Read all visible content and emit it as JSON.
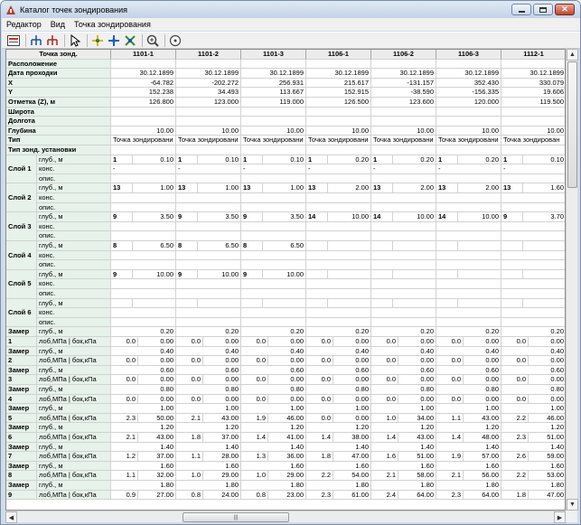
{
  "window": {
    "title": "Каталог точек зондирования"
  },
  "menu": [
    "Редактор",
    "Вид",
    "Точка зондирования"
  ],
  "toolbar": {
    "icons": [
      "report-icon",
      "sort-tree-blue-icon",
      "sort-tree-red-icon",
      "pointer-icon",
      "point-add-icon",
      "point-move-icon",
      "point-delete-icon",
      "zoom-icon",
      "target-icon"
    ]
  },
  "grid": {
    "corner": "Точка зонд.",
    "columns": [
      "1101-1",
      "1101-2",
      "1101-3",
      "1106-1",
      "1106-2",
      "1106-3",
      "1112-1"
    ],
    "rows": [
      {
        "label": "Расположение",
        "values": [
          "",
          "",
          "",
          "",
          "",
          "",
          ""
        ]
      },
      {
        "label": "Дата проходки",
        "values": [
          "30.12.1899",
          "30.12.1899",
          "30.12.1899",
          "30.12.1899",
          "30.12.1899",
          "30.12.1899",
          "30.12.1899"
        ]
      },
      {
        "label": "X",
        "values": [
          "-64.782",
          "-202.272",
          "256.931",
          "215.617",
          "-131.157",
          "352.430",
          "330.079"
        ]
      },
      {
        "label": "Y",
        "values": [
          "152.238",
          "34.493",
          "113.667",
          "152.915",
          "-38.590",
          "-156.335",
          "19.606"
        ]
      },
      {
        "label": "Отметка (Z), м",
        "values": [
          "126.800",
          "123.000",
          "119.000",
          "126.500",
          "123.600",
          "120.000",
          "119.500"
        ]
      },
      {
        "label": "Широта",
        "values": [
          "",
          "",
          "",
          "",
          "",
          "",
          ""
        ]
      },
      {
        "label": "Долгота",
        "values": [
          "",
          "",
          "",
          "",
          "",
          "",
          ""
        ]
      },
      {
        "label": "Глубина",
        "values": [
          "10.00",
          "10.00",
          "10.00",
          "10.00",
          "10.00",
          "10.00",
          "10.00"
        ]
      },
      {
        "label": "Тип",
        "values": [
          "Точка зондировани",
          "Точка зондировани",
          "Точка зондировани",
          "Точка зондировани",
          "Точка зондировани",
          "Точка зондировани",
          "Точка зондирован"
        ]
      },
      {
        "label": "Тип зонд. установки",
        "values": [
          "",
          "",
          "",
          "",
          "",
          "",
          ""
        ]
      }
    ],
    "layer_sub": [
      "глуб., м",
      "конс.",
      "опис."
    ],
    "layers": [
      {
        "label": "Слой 1",
        "cells": [
          [
            "1",
            "0.10"
          ],
          [
            "1",
            "0.10"
          ],
          [
            "1",
            "0.10"
          ],
          [
            "1",
            "0.20"
          ],
          [
            "1",
            "0.20"
          ],
          [
            "1",
            "0.20"
          ],
          [
            "1",
            "0.10"
          ]
        ],
        "cons": [
          "-",
          "-",
          "-",
          "-",
          "-",
          "-",
          "-"
        ]
      },
      {
        "label": "Слой 2",
        "cells": [
          [
            "13",
            "1.00"
          ],
          [
            "13",
            "1.00"
          ],
          [
            "13",
            "1.00"
          ],
          [
            "13",
            "2.00"
          ],
          [
            "13",
            "2.00"
          ],
          [
            "13",
            "2.00"
          ],
          [
            "13",
            "1.60"
          ]
        ],
        "cons": [
          "",
          "",
          "",
          "",
          "",
          "",
          ""
        ]
      },
      {
        "label": "Слой 3",
        "cells": [
          [
            "9",
            "3.50"
          ],
          [
            "9",
            "3.50"
          ],
          [
            "9",
            "3.50"
          ],
          [
            "14",
            "10.00"
          ],
          [
            "14",
            "10.00"
          ],
          [
            "14",
            "10.00"
          ],
          [
            "9",
            "3.70"
          ]
        ],
        "cons": [
          "",
          "",
          "",
          "",
          "",
          "",
          ""
        ]
      },
      {
        "label": "Слой 4",
        "cells": [
          [
            "8",
            "6.50"
          ],
          [
            "8",
            "6.50"
          ],
          [
            "8",
            "6.50"
          ],
          [
            "",
            ""
          ],
          [
            "",
            ""
          ],
          [
            "",
            ""
          ],
          [
            "",
            ""
          ]
        ],
        "cons": [
          "",
          "",
          "",
          "",
          "",
          "",
          ""
        ]
      },
      {
        "label": "Слой 5",
        "cells": [
          [
            "9",
            "10.00"
          ],
          [
            "9",
            "10.00"
          ],
          [
            "9",
            "10.00"
          ],
          [
            "",
            ""
          ],
          [
            "",
            ""
          ],
          [
            "",
            ""
          ],
          [
            "",
            ""
          ]
        ],
        "cons": [
          "",
          "",
          "",
          "",
          "",
          "",
          ""
        ]
      },
      {
        "label": "Слой 6",
        "cells": [
          [
            "",
            ""
          ],
          [
            "",
            ""
          ],
          [
            "",
            ""
          ],
          [
            "",
            ""
          ],
          [
            "",
            ""
          ],
          [
            "",
            ""
          ],
          [
            "",
            ""
          ]
        ],
        "cons": [
          "",
          "",
          "",
          "",
          "",
          "",
          ""
        ]
      }
    ],
    "meas_label": "Замер",
    "meas_sub": [
      "глуб., м",
      "лоб,МПа | бок,кПа"
    ],
    "measurements": [
      {
        "n": "1",
        "depth": "0.20",
        "vals": [
          [
            "0.0",
            "0.00"
          ],
          [
            "0.0",
            "0.00"
          ],
          [
            "0.0",
            "0.00"
          ],
          [
            "0.0",
            "0.00"
          ],
          [
            "0.0",
            "0.00"
          ],
          [
            "0.0",
            "0.00"
          ],
          [
            "0.0",
            "0.00"
          ]
        ]
      },
      {
        "n": "2",
        "depth": "0.40",
        "vals": [
          [
            "0.0",
            "0.00"
          ],
          [
            "0.0",
            "0.00"
          ],
          [
            "0.0",
            "0.00"
          ],
          [
            "0.0",
            "0.00"
          ],
          [
            "0.0",
            "0.00"
          ],
          [
            "0.0",
            "0.00"
          ],
          [
            "0.0",
            "0.00"
          ]
        ]
      },
      {
        "n": "3",
        "depth": "0.60",
        "vals": [
          [
            "0.0",
            "0.00"
          ],
          [
            "0.0",
            "0.00"
          ],
          [
            "0.0",
            "0.00"
          ],
          [
            "0.0",
            "0.00"
          ],
          [
            "0.0",
            "0.00"
          ],
          [
            "0.0",
            "0.00"
          ],
          [
            "0.0",
            "0.00"
          ]
        ]
      },
      {
        "n": "4",
        "depth": "0.80",
        "vals": [
          [
            "0.0",
            "0.00"
          ],
          [
            "0.0",
            "0.00"
          ],
          [
            "0.0",
            "0.00"
          ],
          [
            "0.0",
            "0.00"
          ],
          [
            "0.0",
            "0.00"
          ],
          [
            "0.0",
            "0.00"
          ],
          [
            "0.0",
            "0.00"
          ]
        ]
      },
      {
        "n": "5",
        "depth": "1.00",
        "vals": [
          [
            "2.3",
            "50.00"
          ],
          [
            "2.1",
            "43.00"
          ],
          [
            "1.9",
            "46.00"
          ],
          [
            "0.0",
            "0.00"
          ],
          [
            "1.0",
            "34.00"
          ],
          [
            "1.1",
            "43.00"
          ],
          [
            "2.2",
            "46.00"
          ]
        ]
      },
      {
        "n": "6",
        "depth": "1.20",
        "vals": [
          [
            "2.1",
            "43.00"
          ],
          [
            "1.8",
            "37.00"
          ],
          [
            "1.4",
            "41.00"
          ],
          [
            "1.4",
            "38.00"
          ],
          [
            "1.4",
            "43.00"
          ],
          [
            "1.4",
            "48.00"
          ],
          [
            "2.3",
            "51.00"
          ]
        ]
      },
      {
        "n": "7",
        "depth": "1.40",
        "vals": [
          [
            "1.2",
            "37.00"
          ],
          [
            "1.1",
            "28.00"
          ],
          [
            "1.3",
            "36.00"
          ],
          [
            "1.8",
            "47.00"
          ],
          [
            "1.6",
            "51.00"
          ],
          [
            "1.9",
            "57.00"
          ],
          [
            "2.6",
            "59.00"
          ]
        ]
      },
      {
        "n": "8",
        "depth": "1.60",
        "vals": [
          [
            "1.1",
            "32.00"
          ],
          [
            "1.0",
            "29.00"
          ],
          [
            "1.0",
            "29.00"
          ],
          [
            "2.2",
            "54.00"
          ],
          [
            "2.1",
            "58.00"
          ],
          [
            "2.1",
            "56.00"
          ],
          [
            "2.2",
            "53.00"
          ]
        ]
      },
      {
        "n": "9",
        "depth": "1.80",
        "vals": [
          [
            "0.9",
            "27.00"
          ],
          [
            "0.8",
            "24.00"
          ],
          [
            "0.8",
            "23.00"
          ],
          [
            "2.3",
            "61.00"
          ],
          [
            "2.4",
            "64.00"
          ],
          [
            "2.3",
            "64.00"
          ],
          [
            "1.8",
            "47.00"
          ]
        ]
      }
    ]
  },
  "scroll": {
    "h_thumb_label": "|||"
  }
}
